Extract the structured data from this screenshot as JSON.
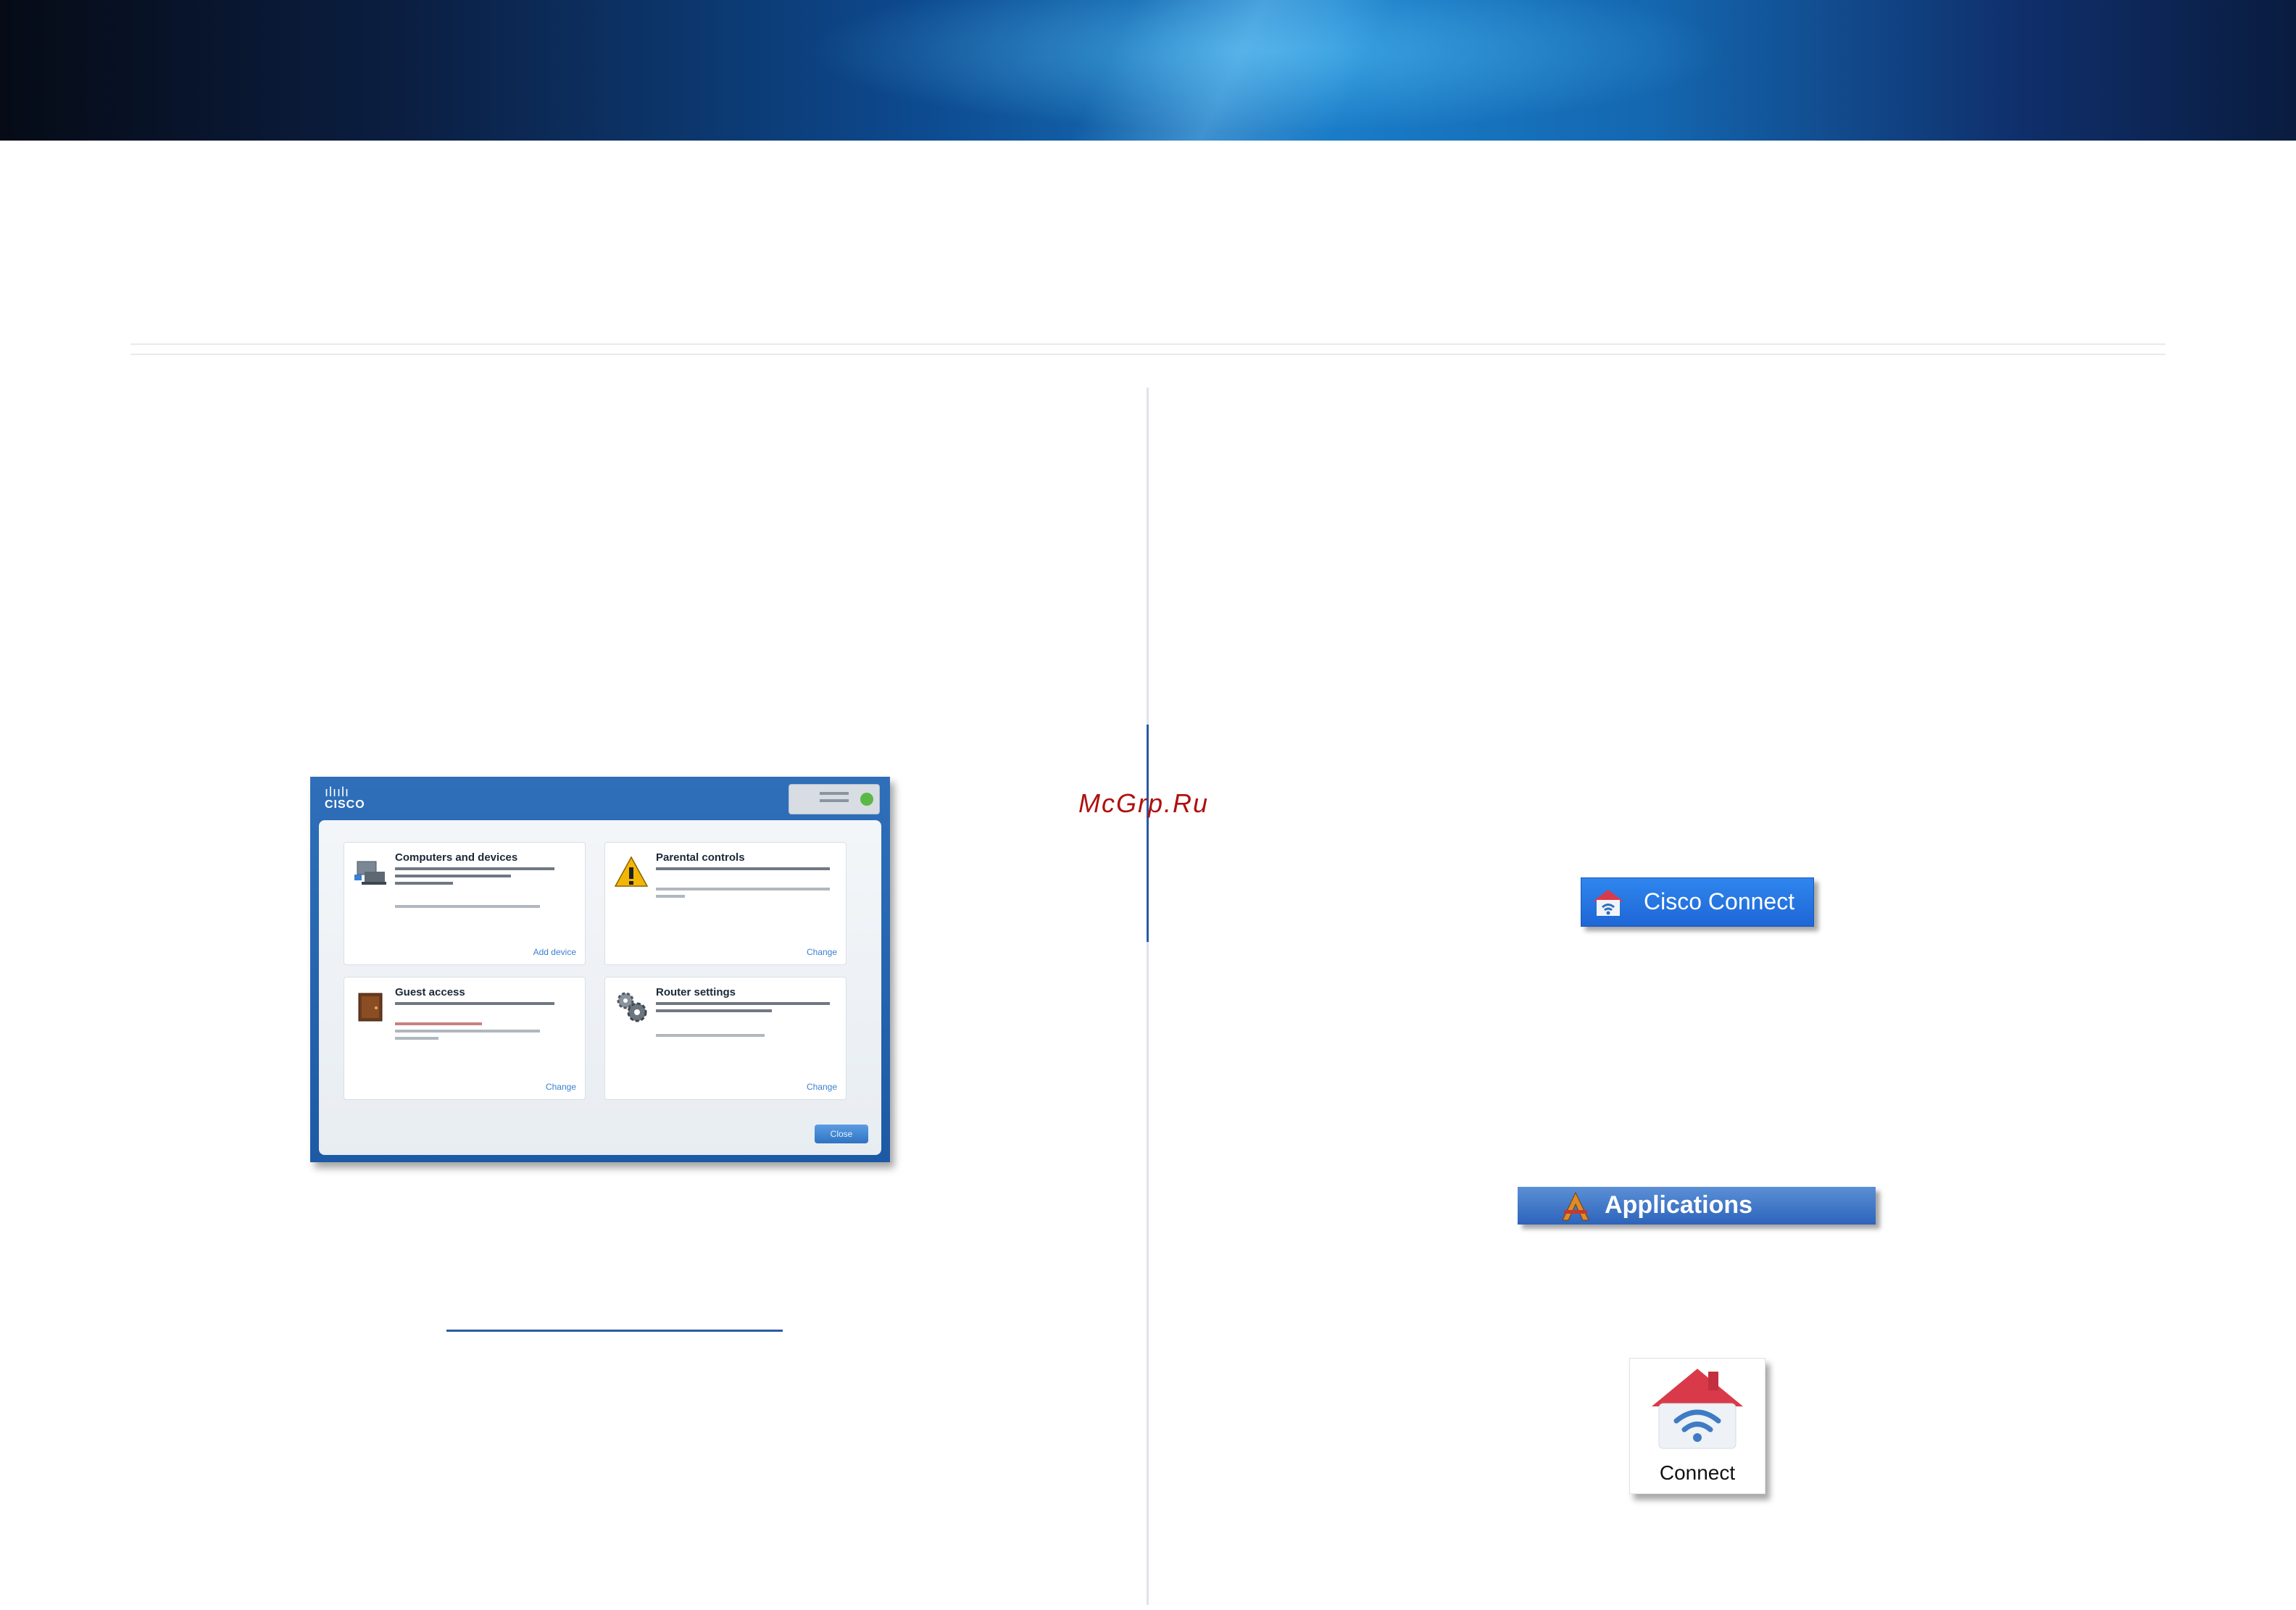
{
  "watermark": "McGrp.Ru",
  "dashboard": {
    "logo_text": "CISCO",
    "logo_bars": "ılıılı",
    "tiles": [
      {
        "title": "Computers and devices",
        "link": "Add device"
      },
      {
        "title": "Parental controls",
        "link": "Change"
      },
      {
        "title": "Guest access",
        "link": "Change"
      },
      {
        "title": "Router settings",
        "link": "Change"
      }
    ],
    "close_label": "Close"
  },
  "cisco_connect_button": {
    "label": "Cisco Connect"
  },
  "applications_bar": {
    "label": "Applications"
  },
  "connect_icon": {
    "label": "Connect"
  },
  "colors": {
    "accent_blue": "#1e66d6",
    "house_red": "#d93a4a",
    "status_green": "#5bb846"
  }
}
